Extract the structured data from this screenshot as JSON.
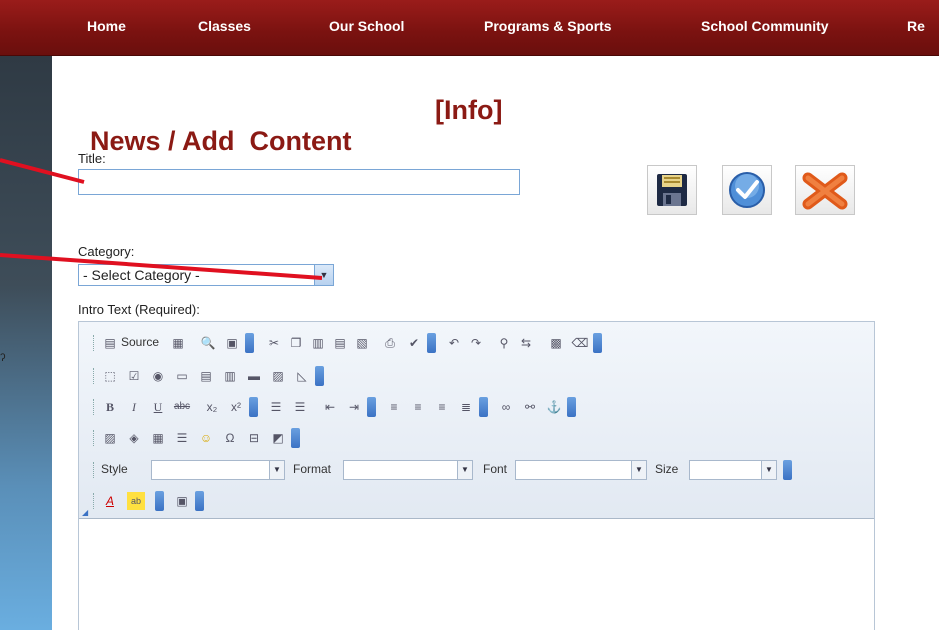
{
  "nav": {
    "items": [
      "Home",
      "Classes",
      "Our School",
      "Programs & Sports",
      "School Community",
      "Re"
    ]
  },
  "page": {
    "heading": "News / Add  Content",
    "info": "[Info]"
  },
  "form": {
    "title_label": "Title:",
    "title_value": "",
    "category_label": "Category:",
    "category_selected": "- Select Category -",
    "intro_label": "Intro Text (Required):"
  },
  "toolbar": {
    "source_label": "Source",
    "style_label": "Style",
    "format_label": "Format",
    "font_label": "Font",
    "size_label": "Size"
  },
  "colors": {
    "nav_bg": "#7a1210",
    "heading": "#8b1a14",
    "annotation": "#e01020"
  }
}
